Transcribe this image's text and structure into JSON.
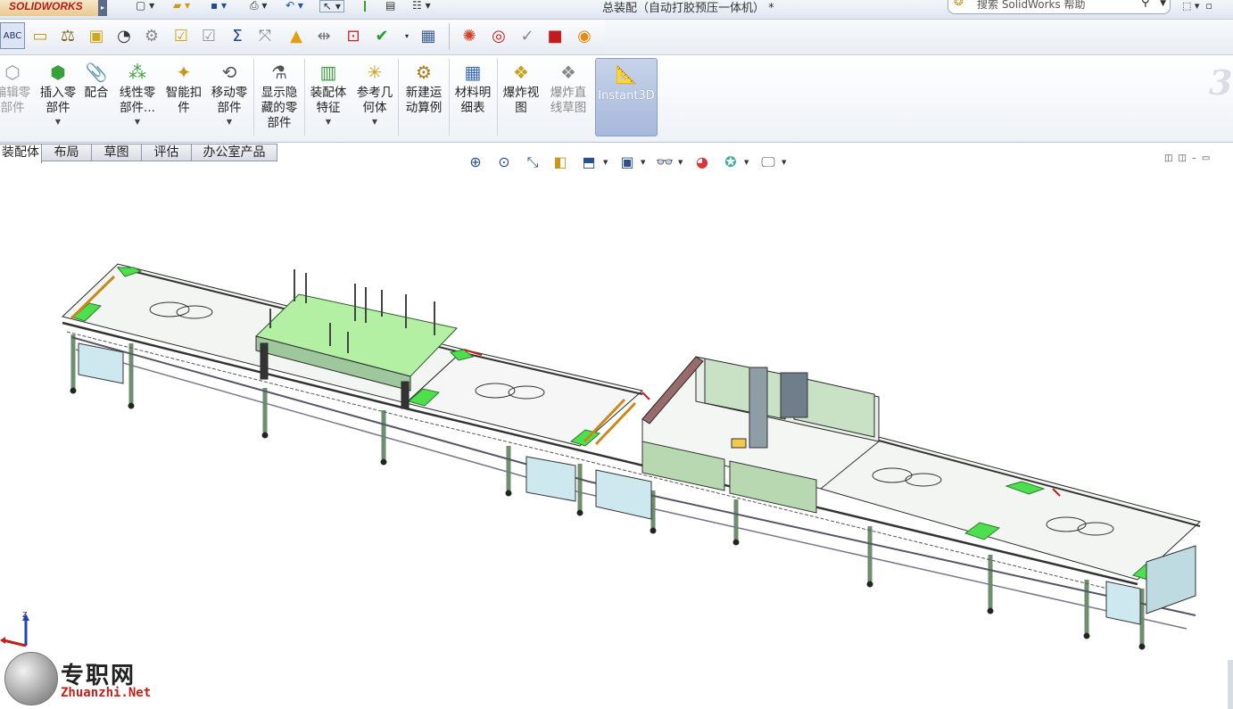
{
  "titlebar": {
    "app_logo": "SOLIDWORKS",
    "document_title": "总装配（自动打胶预压一体机） *",
    "help_search_placeholder": "搜索 SolidWorks 帮助"
  },
  "ribbon": {
    "buttons": [
      {
        "label": "编辑零\n部件",
        "icon": "edit-component-icon"
      },
      {
        "label": "插入零\n部件",
        "icon": "insert-component-icon",
        "has_caret": true
      },
      {
        "label": "配合",
        "icon": "mate-icon"
      },
      {
        "label": "线性零\n部件...",
        "icon": "linear-pattern-icon",
        "has_caret": true
      },
      {
        "label": "智能扣\n件",
        "icon": "smart-fasteners-icon"
      },
      {
        "label": "移动零\n部件",
        "icon": "move-component-icon",
        "has_caret": true
      },
      {
        "label": "显示隐\n藏的零\n部件",
        "icon": "show-hidden-icon"
      },
      {
        "label": "装配体\n特征",
        "icon": "assembly-features-icon",
        "has_caret": true
      },
      {
        "label": "参考几\n何体",
        "icon": "reference-geometry-icon",
        "has_caret": true
      },
      {
        "label": "新建运\n动算例",
        "icon": "motion-study-icon"
      },
      {
        "label": "材料明\n细表",
        "icon": "bill-of-materials-icon"
      },
      {
        "label": "爆炸视\n图",
        "icon": "exploded-view-icon"
      },
      {
        "label": "爆炸直\n线草图",
        "icon": "explode-line-sketch-icon"
      }
    ],
    "instant3d": {
      "label": "Instant3D",
      "active": true
    }
  },
  "tabs": [
    {
      "label": "装配体",
      "active": true
    },
    {
      "label": "布局"
    },
    {
      "label": "草图"
    },
    {
      "label": "评估"
    },
    {
      "label": "办公室产品"
    }
  ],
  "triad": {
    "z_label": "Z"
  },
  "watermark": {
    "cn": "专职网",
    "en": "Zhuanzhi.Net"
  },
  "colors": {
    "frame": "#8fb48f",
    "plate_green": "#4ddf4d",
    "cabinet": "#cde8ee",
    "line": "#2a2a2a"
  }
}
